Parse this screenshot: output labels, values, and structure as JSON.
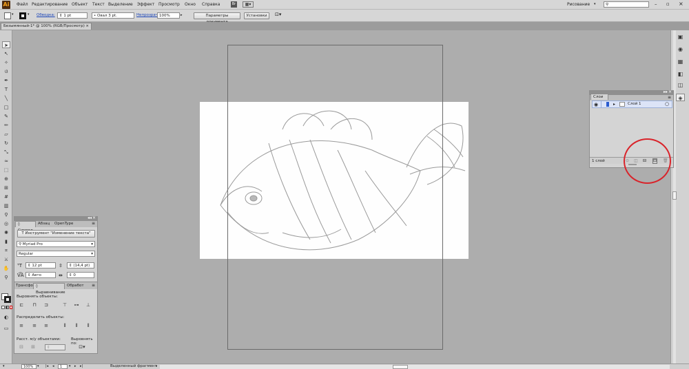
{
  "menubar": {
    "logo": "Ai",
    "items": [
      "Файл",
      "Редактирование",
      "Объект",
      "Текст",
      "Выделение",
      "Эффект",
      "Просмотр",
      "Окно",
      "Справка"
    ],
    "workspace": "Рисование",
    "search_placeholder": ""
  },
  "control_bar": {
    "stroke_label": "Обводка:",
    "stroke_value": "1 pt",
    "brush_value": "Овал 3 pt.",
    "opacity_label": "Непрозрачность:",
    "opacity_value": "100%",
    "doc_setup_button": "Параметры документа",
    "preferences_button": "Установки"
  },
  "document_tab": {
    "title": "Безымянный-1* @ 100% (RGB/Просмотр)",
    "close": "×"
  },
  "layers_panel": {
    "tab": "Слои",
    "layer_name": "Слой 1",
    "footer_count": "1 слой"
  },
  "character_panel": {
    "tabs": [
      "◊ Символ",
      "Абзац",
      "OpenType"
    ],
    "tool_button": "Инструмент \"Изменение текста\"",
    "font_family": "Myriad Pro",
    "font_style": "Regular",
    "font_size": "12 pt",
    "leading": "(14,4 pt)",
    "kerning": "Авто",
    "tracking": "0"
  },
  "align_panel": {
    "tabs": [
      "Трансфо",
      "◊ Выравнивание",
      "Обработ"
    ],
    "align_objects_label": "Выровнять объекты:",
    "distribute_objects_label": "Распределить объекты:",
    "distribute_spacing_label": "Расст. м/у объектами:",
    "align_to_label": "Выровнять по:"
  },
  "status_bar": {
    "zoom": "100%",
    "page": "1",
    "status_text": "Выделенный фрагмент"
  },
  "colors": {
    "annotation_circle": "#d9232a",
    "layer_highlight": "#dce4f7"
  }
}
